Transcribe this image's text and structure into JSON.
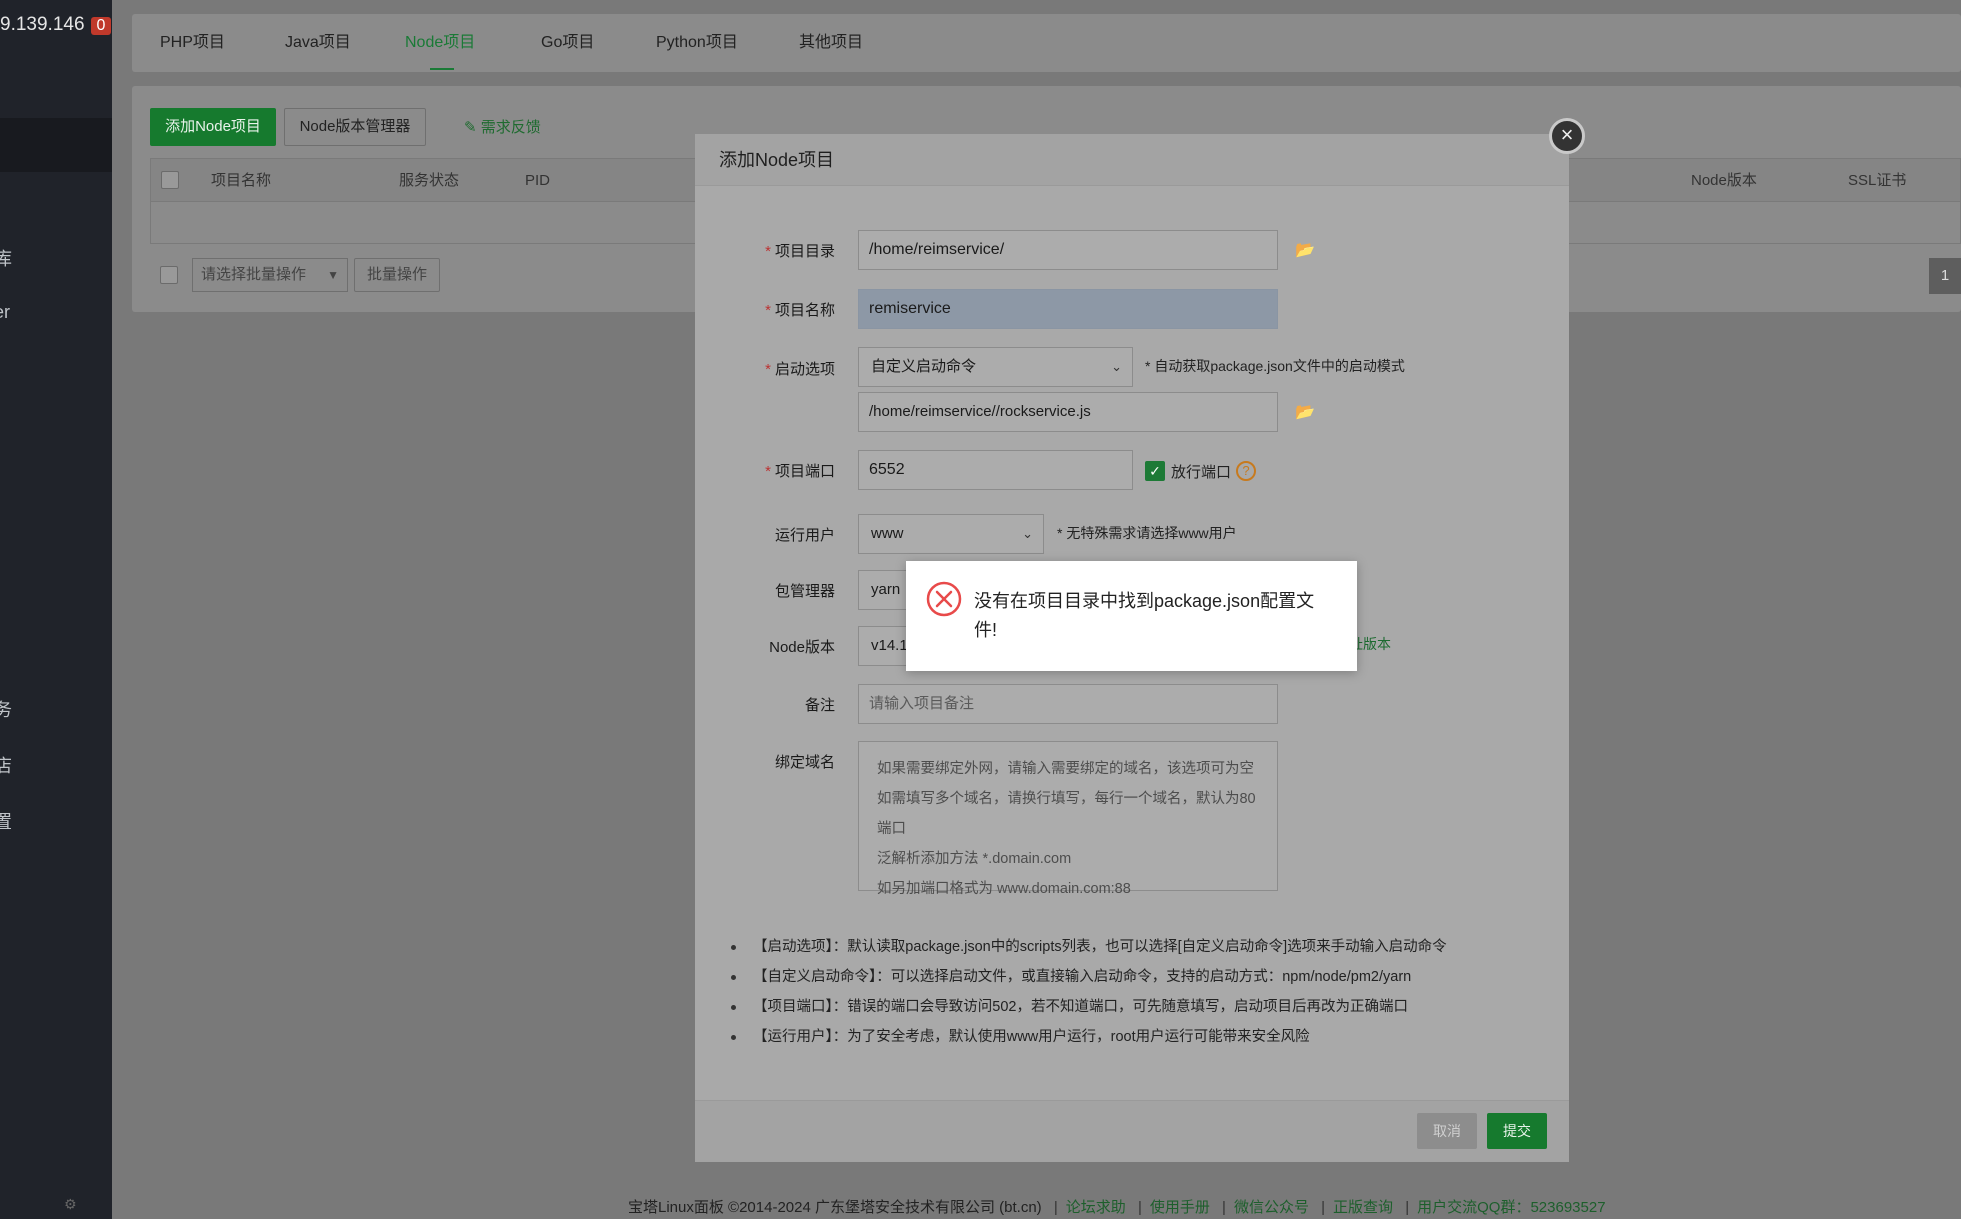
{
  "sidebar": {
    "ip": "9.139.146",
    "badge": "0",
    "items": [
      "库",
      "er",
      "务",
      "店",
      "置"
    ]
  },
  "tabs": [
    "PHP项目",
    "Java项目",
    "Node项目",
    "Go项目",
    "Python项目",
    "其他项目"
  ],
  "active_tab": "Node项目",
  "toolbar": {
    "add_node": "添加Node项目",
    "version_manager": "Node版本管理器",
    "feedback": "需求反馈"
  },
  "table": {
    "headers": [
      "项目名称",
      "服务状态",
      "PID",
      "Node版本",
      "SSL证书"
    ],
    "batch_select": "请选择批量操作",
    "batch_button": "批量操作",
    "page": "1"
  },
  "modal": {
    "title": "添加Node项目",
    "close": "×",
    "fields": {
      "project_dir_label": "项目目录",
      "project_dir_value": "/home/reimservice/",
      "project_name_label": "项目名称",
      "project_name_value": "remiservice",
      "start_option_label": "启动选项",
      "start_option_value": "自定义启动命令",
      "start_option_hint": "* 自动获取package.json文件中的启动模式",
      "start_cmd_value": "/home/reimservice//rockservice.js",
      "port_label": "项目端口",
      "port_value": "6552",
      "open_port_label": "放行端口",
      "run_user_label": "运行用户",
      "run_user_value": "www",
      "run_user_hint": "* 无特殊需求请选择www用户",
      "pkg_manager_label": "包管理器",
      "pkg_manager_value": "yarn",
      "node_version_label": "Node版本",
      "node_version_value": "v14.1",
      "node_version_link": "址版本",
      "remark_label": "备注",
      "remark_placeholder": "请输入项目备注",
      "domain_label": "绑定域名",
      "domain_placeholder": [
        "如果需要绑定外网，请输入需要绑定的域名，该选项可为空",
        "如需填写多个域名，请换行填写，每行一个域名，默认为80端口",
        "泛解析添加方法 *.domain.com",
        "如另加端口格式为 www.domain.com:88"
      ]
    },
    "notes": [
      "【启动选项】：默认读取package.json中的scripts列表，也可以选择[自定义启动命令]选项来手动输入启动命令",
      "【自定义启动命令】：可以选择启动文件，或直接输入启动命令，支持的启动方式：npm/node/pm2/yarn",
      "【项目端口】：错误的端口会导致访问502，若不知道端口，可先随意填写，启动项目后再改为正确端口",
      "【运行用户】：为了安全考虑，默认使用www用户运行，root用户运行可能带来安全风险"
    ],
    "cancel": "取消",
    "submit": "提交"
  },
  "toast": {
    "message": "没有在项目目录中找到package.json配置文件!"
  },
  "footer": {
    "copyright": "宝塔Linux面板 ©2014-2024 广东堡塔安全技术有限公司 (bt.cn)",
    "links": [
      "论坛求助",
      "使用手册",
      "微信公众号",
      "正版查询",
      "用户交流QQ群：523693527"
    ]
  },
  "colors": {
    "accent": "#20a53a",
    "error": "#e84a4a",
    "warning": "#f0a030"
  }
}
